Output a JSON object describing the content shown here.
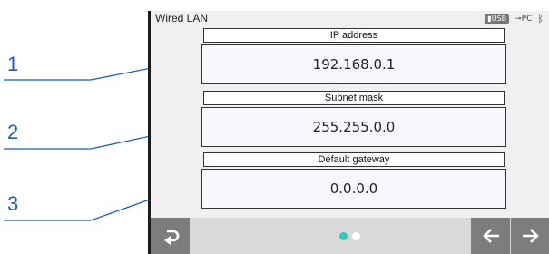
{
  "callouts": {
    "labels": [
      "1",
      "2",
      "3"
    ]
  },
  "statusbar": {
    "title": "Wired LAN",
    "usb_label": "USB",
    "pc_label": "PC",
    "bluetooth_icon": "bluetooth-icon"
  },
  "fields": [
    {
      "label": "IP address",
      "value": "192.168.0.1"
    },
    {
      "label": "Subnet mask",
      "value": "255.255.0.0"
    },
    {
      "label": "Default gateway",
      "value": "0.0.0.0"
    }
  ],
  "nav": {
    "back_icon": "return-icon",
    "prev_icon": "arrow-left-icon",
    "next_icon": "arrow-right-icon",
    "page_indicator": {
      "total": 2,
      "current": 1,
      "active_color": "#2ecbb7",
      "inactive_color": "#ffffff"
    }
  },
  "colors": {
    "callout": "#1a5fb4",
    "button": "#7d7d7d",
    "bar": "#d9d9d9"
  }
}
